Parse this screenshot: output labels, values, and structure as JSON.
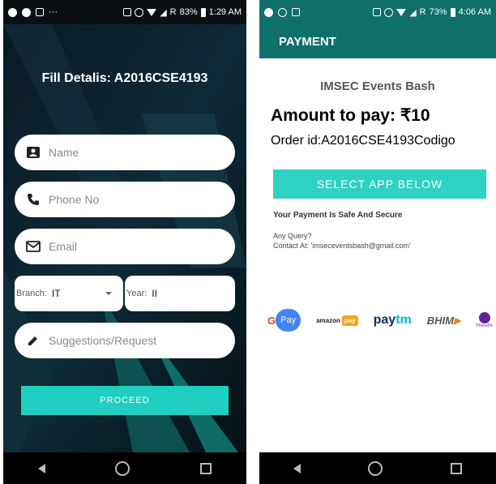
{
  "left_phone": {
    "status_bar": {
      "battery": "83%",
      "time": "1:29 AM",
      "carrier_mark": "R"
    },
    "title": "Fill Detalis: A2016CSE4193",
    "fields": {
      "name_placeholder": "Name",
      "phone_placeholder": "Phone No",
      "email_placeholder": "Email",
      "suggestions_placeholder": "Suggestions/Request"
    },
    "branch": {
      "label": "Branch:",
      "value": "IT"
    },
    "year": {
      "label": "Year:",
      "value": "II"
    },
    "proceed_label": "PROCEED"
  },
  "right_phone": {
    "status_bar": {
      "battery": "73%",
      "time": "4:06 AM",
      "carrier_mark": "R"
    },
    "header_title": "PAYMENT",
    "event_name": "IMSEC Events Bash",
    "amount": "Amount to pay: ₹10",
    "order_id": "Order id:A2016CSE4193Codigo",
    "select_app_label": "SELECT APP BELOW",
    "safe_text": "Your Payment Is Safe And Secure",
    "query_line1": "Any Query?",
    "query_line2": "Contact At: 'imseceventsbash@gmail.com'",
    "apps": {
      "gpay_g": "G",
      "gpay_pay": "Pay",
      "amazon": "amazon",
      "amazon_pay": "pay",
      "paytm_pay": "pay",
      "paytm_tm": "tm",
      "bhim": "BHIM",
      "phonepe": "PhonePe"
    }
  },
  "colors": {
    "accent": "#1fcfc1",
    "header": "#0f6f6a"
  }
}
